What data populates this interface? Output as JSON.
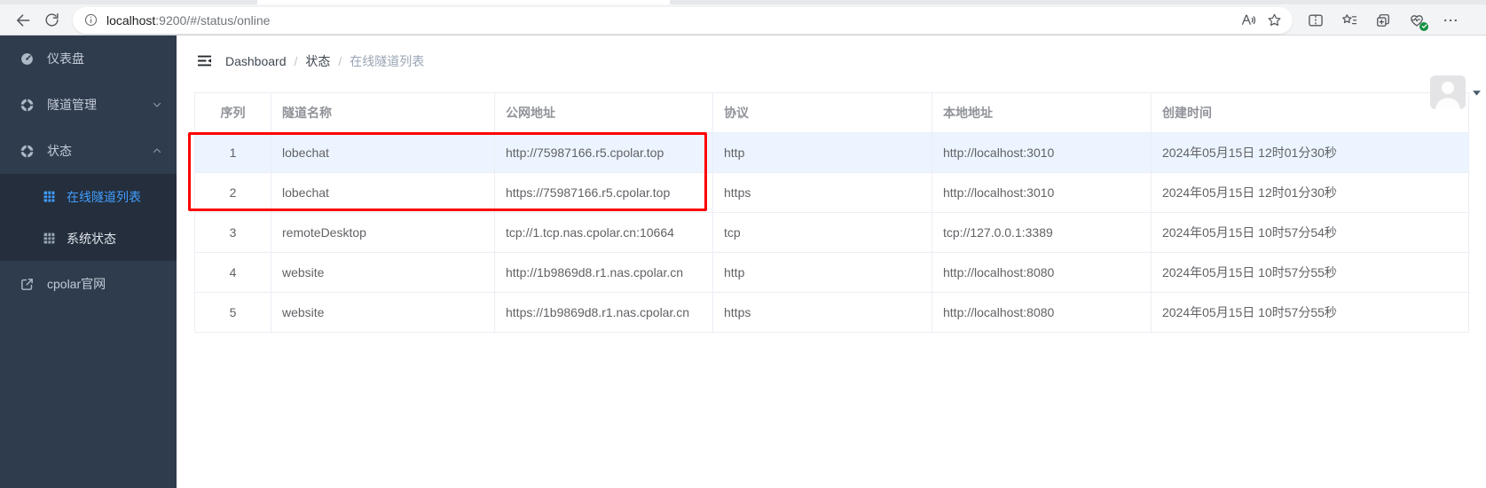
{
  "browser": {
    "url": {
      "host": "localhost",
      "path": ":9200/#/status/online"
    },
    "icons": {
      "back": "arrow-left",
      "refresh": "circular-arrow",
      "site_info": "info-circle",
      "read_aloud": "letter-A-with-sound-waves",
      "favorite_this_page": "star-outline",
      "split_screen": "rect-with-dashed-divider",
      "favorites": "star-with-list-lines",
      "collections": "stacked-squares-plus",
      "browser_essentials": "heart-pulse-green-check",
      "settings_menu": "three-dots"
    }
  },
  "header": {
    "breadcrumb": {
      "separator": "/",
      "items": [
        {
          "label": "Dashboard"
        },
        {
          "label": "状态"
        },
        {
          "label": "在线隧道列表"
        }
      ]
    },
    "user": {
      "avatar": "person-silhouette-placeholder",
      "caret": "caret-down"
    }
  },
  "sidebar": {
    "menu": [
      {
        "label": "仪表盘",
        "icon": "gauge-icon"
      },
      {
        "label": "隧道管理",
        "icon": "life-buoy-icon",
        "chevron": "down"
      },
      {
        "label": "状态",
        "icon": "life-buoy-icon",
        "chevron": "up"
      }
    ],
    "submenu": [
      {
        "label": "在线隧道列表",
        "icon": "grid-icon",
        "active": true
      },
      {
        "label": "系统状态",
        "icon": "grid-icon",
        "active": false
      }
    ],
    "site_link": {
      "label": "cpolar官网",
      "icon": "external-link-icon"
    }
  },
  "table": {
    "headers": [
      "序列",
      "隧道名称",
      "公网地址",
      "协议",
      "本地地址",
      "创建时间"
    ],
    "rows": [
      [
        "1",
        "lobechat",
        "http://75987166.r5.cpolar.top",
        "http",
        "http://localhost:3010",
        "2024年05月15日 12时01分30秒"
      ],
      [
        "2",
        "lobechat",
        "https://75987166.r5.cpolar.top",
        "https",
        "http://localhost:3010",
        "2024年05月15日 12时01分30秒"
      ],
      [
        "3",
        "remoteDesktop",
        "tcp://1.tcp.nas.cpolar.cn:10664",
        "tcp",
        "tcp://127.0.0.1:3389",
        "2024年05月15日 10时57分54秒"
      ],
      [
        "4",
        "website",
        "http://1b9869d8.r1.nas.cpolar.cn",
        "http",
        "http://localhost:8080",
        "2024年05月15日 10时57分55秒"
      ],
      [
        "5",
        "website",
        "https://1b9869d8.r1.nas.cpolar.cn",
        "https",
        "http://localhost:8080",
        "2024年05月15日 10时57分55秒"
      ]
    ],
    "highlighted_row_index": 0,
    "annotated_rows": [
      0,
      1
    ]
  },
  "colors": {
    "accent": "#409eff",
    "sidebar_bg": "#2f3c4e",
    "submenu_bg": "#242e3c",
    "sidebar_text": "#c3cbd6",
    "row_highlight": "#ecf4ff",
    "annotation": "#fe0000",
    "table_border": "#ebeef5",
    "header_text": "#909399",
    "cell_text": "#606266",
    "breadcrumb_muted": "#99a5b5"
  }
}
